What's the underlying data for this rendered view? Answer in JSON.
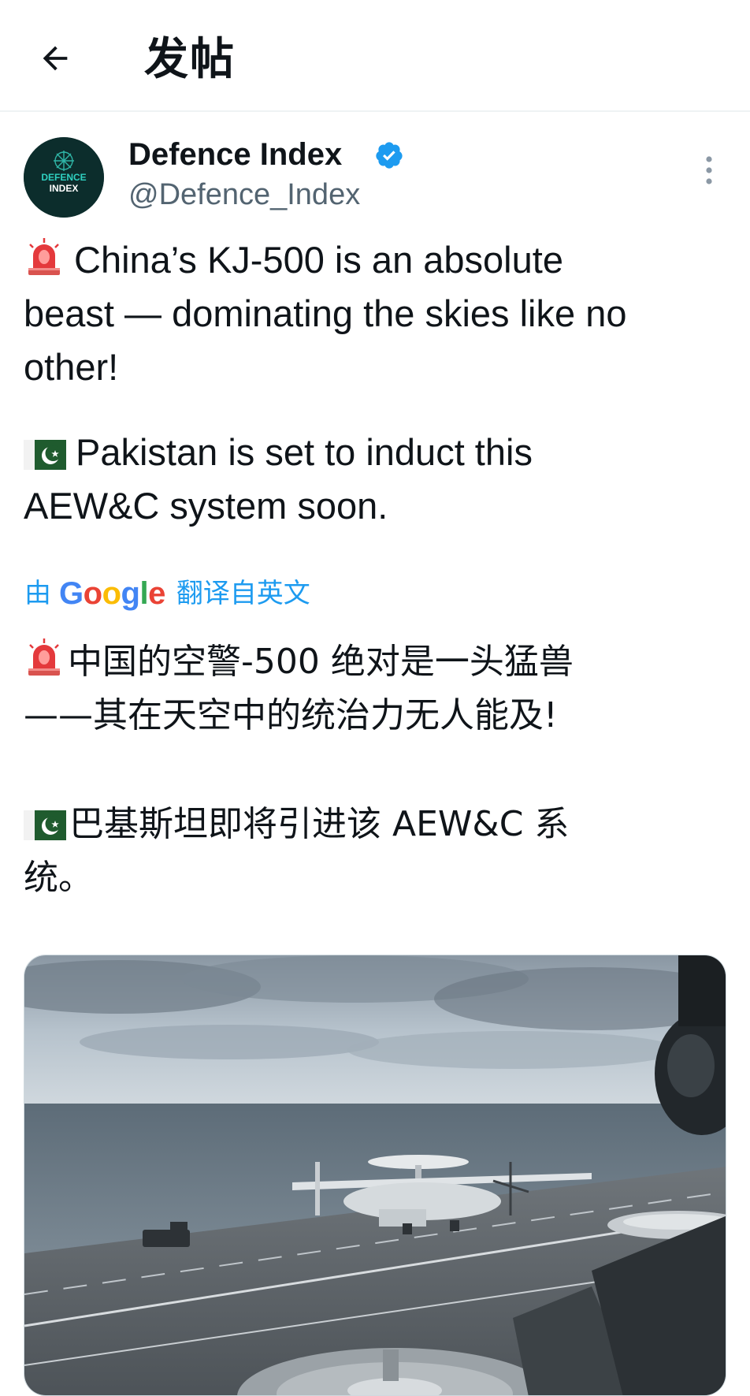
{
  "header": {
    "title": "发帖",
    "back_icon": "arrow-left-icon"
  },
  "post": {
    "author": {
      "name": "Defence Index",
      "handle": "@Defence_Index",
      "verified": true,
      "avatar_text_line1": "DEFENCE",
      "avatar_text_line2": "INDEX"
    },
    "more_icon": "more-vertical-icon",
    "original_text": {
      "line1": "China’s KJ-500 is an absolute",
      "line2": "beast — dominating the skies like no",
      "line3": "other!",
      "line4": "Pakistan is set to induct this",
      "line5": "AEW&C system soon."
    },
    "translation": {
      "prefix": "由",
      "provider": "Google",
      "suffix": "翻译自英文"
    },
    "translated_text": {
      "line1": "中国的空警-500 绝对是一头猛兽",
      "line2": "——其在天空中的统治力无人能及!",
      "line3": "巴基斯坦即将引进该 AEW&C 系",
      "line4": "统。"
    },
    "media": {
      "type": "video-thumbnail"
    }
  },
  "colors": {
    "accent": "#1d9bf0",
    "secondary_text": "#536471",
    "primary_text": "#0f1419"
  }
}
